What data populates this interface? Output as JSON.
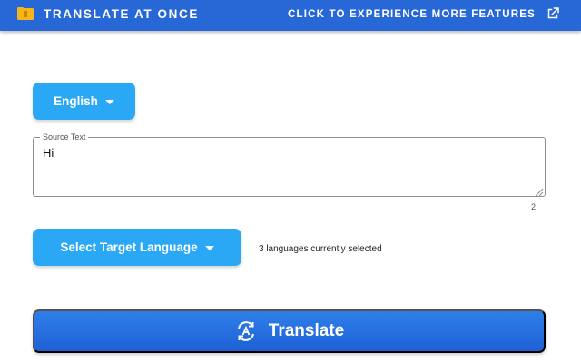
{
  "header": {
    "title": "TRANSLATE AT ONCE",
    "features_link": "CLICK TO EXPERIENCE MORE FEATURES",
    "logo_icon": "folder-icon",
    "external_icon": "external-link-icon",
    "background_color": "#2767d6"
  },
  "source": {
    "language_label": "English",
    "field_label": "Source Text",
    "text": "Hi",
    "char_count": "2"
  },
  "target": {
    "button_label": "Select Target Language",
    "status": "3 languages currently selected"
  },
  "translate": {
    "label": "Translate",
    "icon": "translate-cycle-icon"
  },
  "colors": {
    "accent_light": "#2aa8f6",
    "accent_dark": "#1e60d4"
  }
}
